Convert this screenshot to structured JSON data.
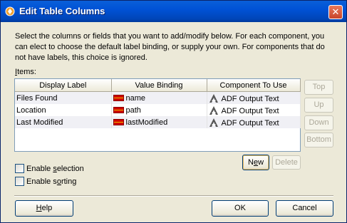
{
  "window": {
    "title": "Edit Table Columns",
    "close_glyph": "✕"
  },
  "description": "Select the columns or fields that you want to add/modify below. For each component, you can elect to choose the default label binding, or supply your own. For components that do not have labels, this choice is ignored.",
  "items_label": {
    "accel": "I",
    "rest": "tems:"
  },
  "table": {
    "columns": [
      "Display Label",
      "Value Binding",
      "Component To Use"
    ],
    "rows": [
      {
        "label": "Files Found",
        "binding": "name",
        "component": "ADF Output Text"
      },
      {
        "label": "Location",
        "binding": "path",
        "component": "ADF Output Text"
      },
      {
        "label": "Last Modified",
        "binding": "lastModified",
        "component": "ADF Output Text"
      }
    ]
  },
  "side_buttons": {
    "top": "Top",
    "up": "Up",
    "down": "Down",
    "bottom": "Bottom"
  },
  "row_buttons": {
    "new_prefix": "N",
    "new_accel": "e",
    "new_suffix": "w",
    "delete": "Delete"
  },
  "options": {
    "enable_selection": {
      "pre": "Enable ",
      "accel": "s",
      "post": "election"
    },
    "enable_sorting": {
      "pre": "Enable s",
      "accel": "o",
      "post": "rting"
    }
  },
  "footer": {
    "help_accel": "H",
    "help_rest": "elp",
    "ok": "OK",
    "cancel": "Cancel"
  }
}
